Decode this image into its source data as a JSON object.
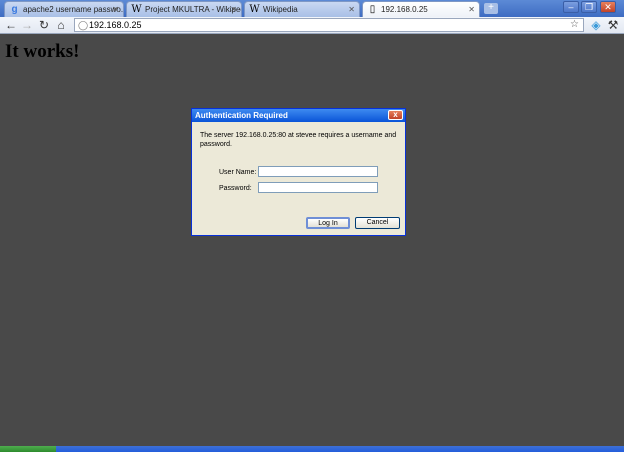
{
  "tabs": [
    {
      "title": "apache2 username passwo...",
      "favicon": "google-icon"
    },
    {
      "title": "Project MKULTRA - Wikiped...",
      "favicon": "W"
    },
    {
      "title": "Wikipedia",
      "favicon": "W"
    },
    {
      "title": "192.168.0.25",
      "favicon": "page-icon"
    }
  ],
  "address_bar": {
    "url": "192.168.0.25"
  },
  "page": {
    "heading": "It works!"
  },
  "dialog": {
    "title": "Authentication Required",
    "message": "The server 192.168.0.25:80 at stevee requires a username and password.",
    "username_label": "User Name:",
    "password_label": "Password:",
    "username_value": "",
    "password_value": "",
    "login_label": "Log In",
    "cancel_label": "Cancel"
  },
  "colors": {
    "page_background": "#494949",
    "titlebar": "#0a54d8",
    "dialog_body": "#ece9d8"
  }
}
